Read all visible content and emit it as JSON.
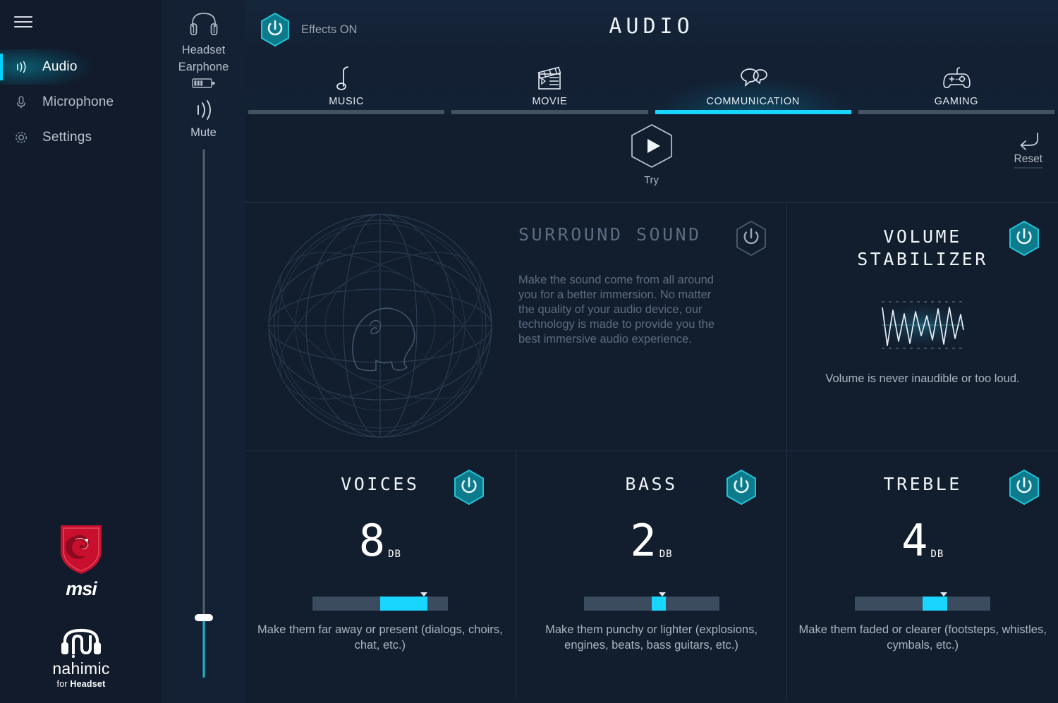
{
  "sidebar": {
    "menu_icon": "hamburger-icon",
    "items": [
      {
        "label": "Audio",
        "icon": "audio-waves-icon",
        "active": true
      },
      {
        "label": "Microphone",
        "icon": "microphone-icon",
        "active": false
      },
      {
        "label": "Settings",
        "icon": "gear-icon",
        "active": false
      }
    ],
    "logos": {
      "msi_word": "msi",
      "nahimic_word": "nahimic",
      "nahimic_sub_prefix": "for ",
      "nahimic_sub_bold": "Headset"
    }
  },
  "device_column": {
    "headset_icon": "headset-icon",
    "device_line1": "Headset",
    "device_line2": "Earphone",
    "battery_icon": "battery-icon",
    "mute_icon": "mute-waves-icon",
    "mute_label": "Mute",
    "volume_slider": {
      "name": "volume-slider",
      "value_percent": 9
    }
  },
  "header": {
    "effects_toggle_icon": "power-icon",
    "effects_label": "Effects ON",
    "effects_on": true,
    "title": "AUDIO"
  },
  "tabs": [
    {
      "label": "MUSIC",
      "icon": "music-note-icon",
      "active": false
    },
    {
      "label": "MOVIE",
      "icon": "clapperboard-icon",
      "active": false
    },
    {
      "label": "COMMUNICATION",
      "icon": "speech-bubbles-icon",
      "active": true
    },
    {
      "label": "GAMING",
      "icon": "gamepad-icon",
      "active": false
    }
  ],
  "actions": {
    "try_icon": "play-icon",
    "try_label": "Try",
    "reset_icon": "undo-arrow-icon",
    "reset_label": "Reset"
  },
  "panels": {
    "surround": {
      "title": "SURROUND SOUND",
      "description": "Make the sound come from all around you for a better immersion. No matter the quality of your audio device, our technology is made to provide you the best immersive audio experience.",
      "toggle_icon": "power-icon",
      "enabled": false,
      "graphic": "surround-sphere-head-icon"
    },
    "volume_stabilizer": {
      "title_line1": "VOLUME",
      "title_line2": "STABILIZER",
      "description": "Volume is never inaudible or too loud.",
      "toggle_icon": "power-icon",
      "enabled": true,
      "graphic": "waveform-icon"
    }
  },
  "bands": [
    {
      "title": "VOICES",
      "value": "8",
      "unit": "DB",
      "enabled": true,
      "toggle_icon": "power-icon",
      "slider_start_percent": 50,
      "slider_end_percent": 85,
      "marker_percent": 82,
      "description": "Make them far away or present (dialogs, choirs, chat, etc.)"
    },
    {
      "title": "BASS",
      "value": "2",
      "unit": "DB",
      "enabled": true,
      "toggle_icon": "power-icon",
      "slider_start_percent": 50,
      "slider_end_percent": 59,
      "marker_percent": 56,
      "description": "Make them punchy or lighter (explosions, engines, beats, bass guitars, etc.)"
    },
    {
      "title": "TREBLE",
      "value": "4",
      "unit": "DB",
      "enabled": true,
      "toggle_icon": "power-icon",
      "slider_start_percent": 50,
      "slider_end_percent": 68,
      "marker_percent": 65,
      "description": "Make them faded or clearer (footsteps, whistles, cymbals, etc.)"
    }
  ],
  "colors": {
    "accent_cyan": "#18d6ff",
    "teal_on": "#0e7b8c",
    "background": "#121e2e",
    "sidebar_bg": "#111b2b",
    "panel_border": "#223048",
    "msi_red": "#c8102e"
  }
}
